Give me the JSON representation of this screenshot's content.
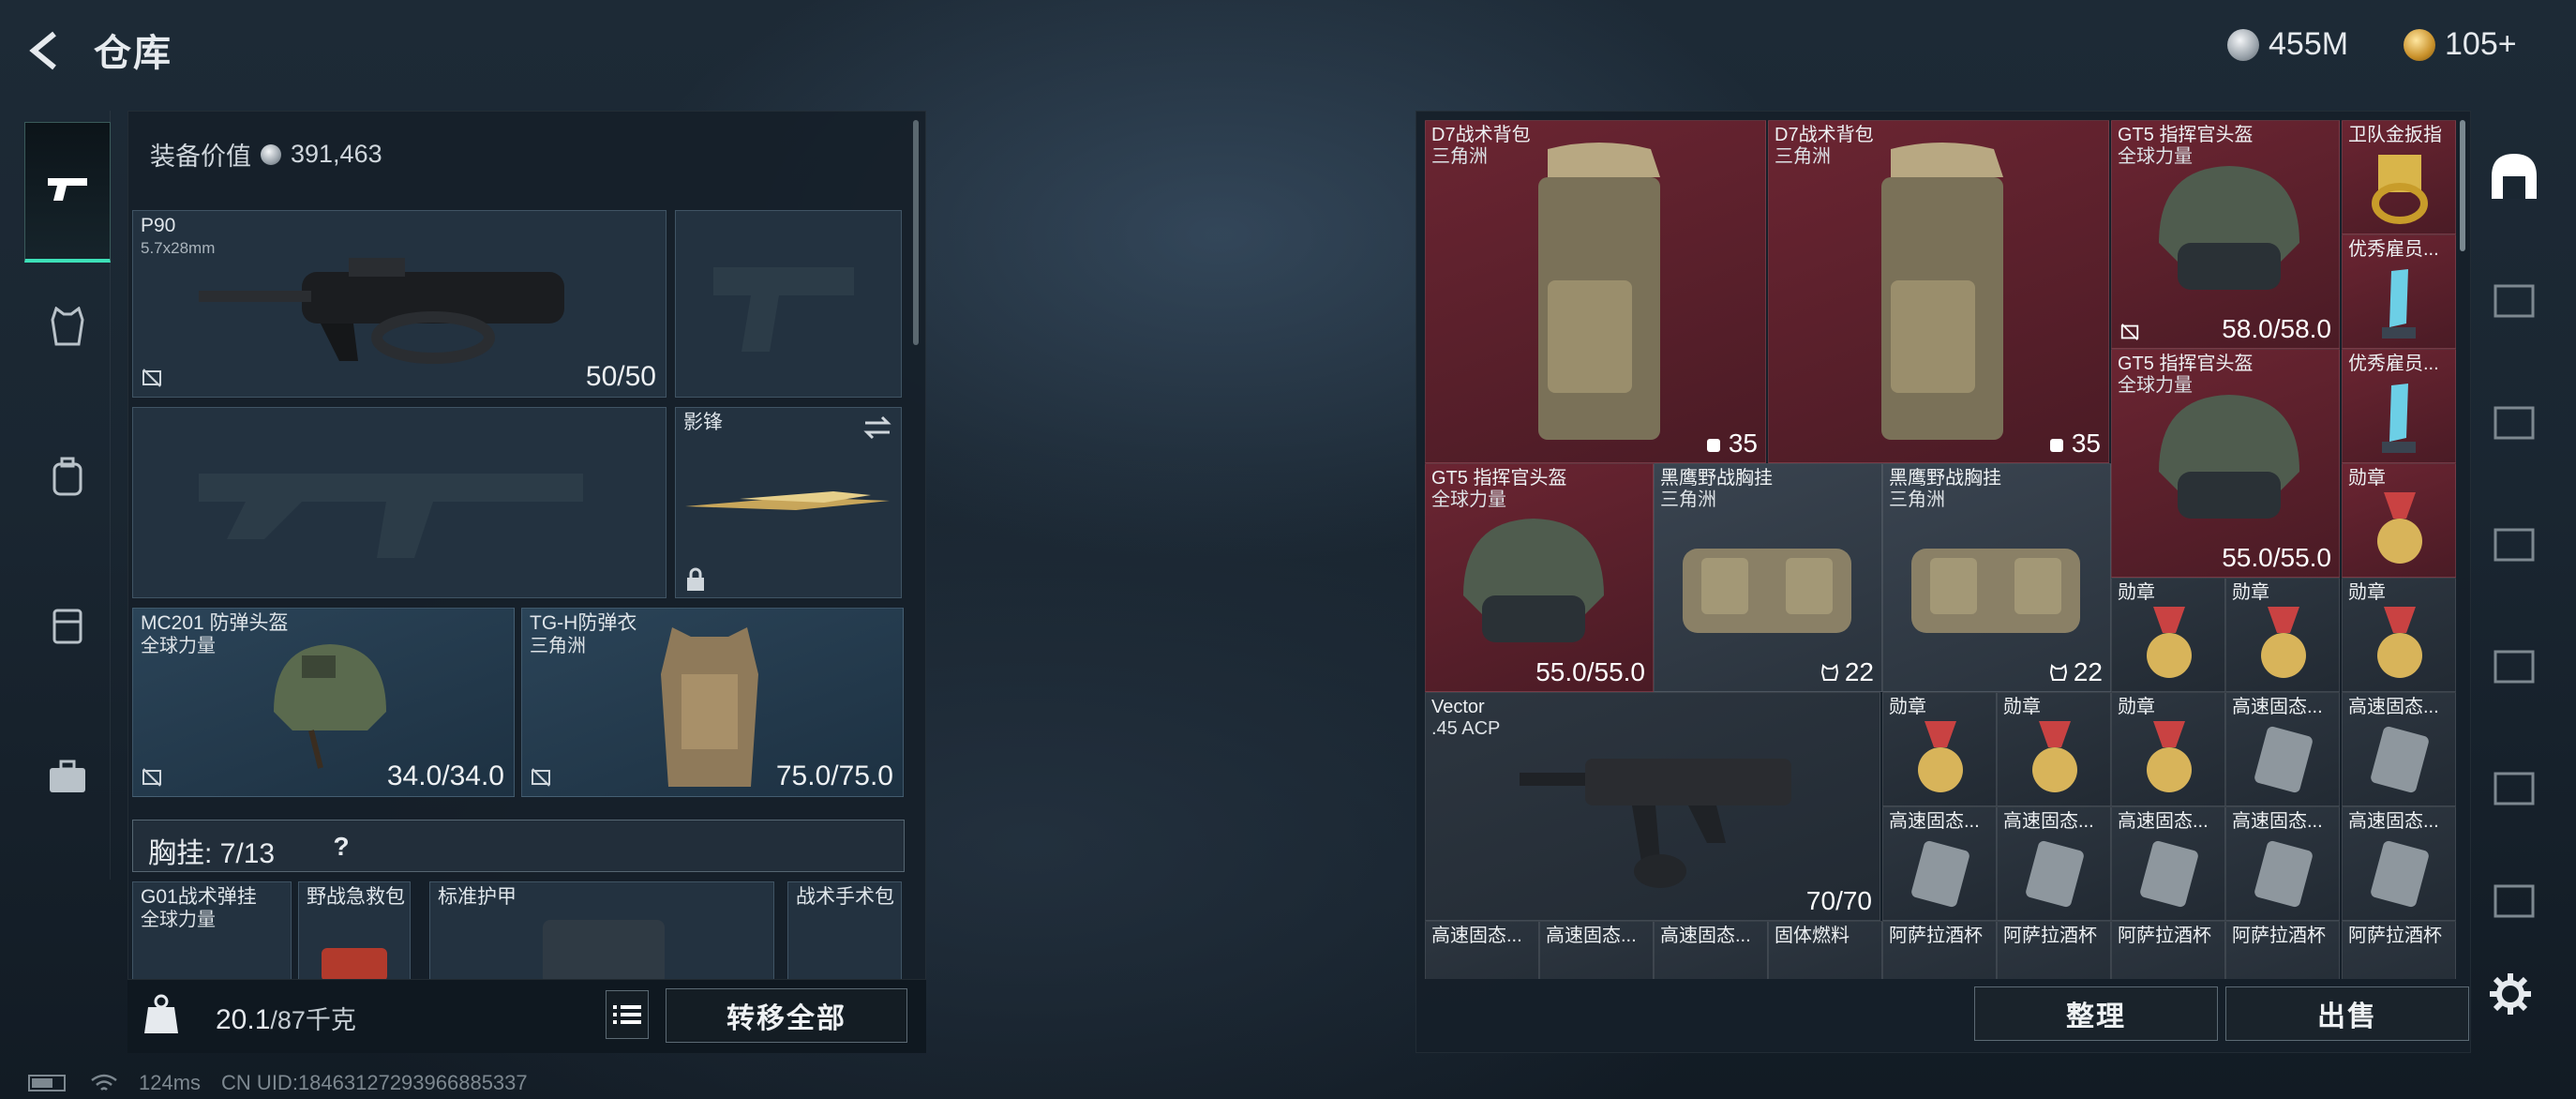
{
  "header": {
    "title": "仓库",
    "currency_silver": "455M",
    "currency_gold": "105+"
  },
  "rail_left": [
    "weapons",
    "armor",
    "backpack",
    "chest-rig",
    "case"
  ],
  "loadout": {
    "equip_value_label": "装备价值",
    "equip_value": "391,463",
    "primary": {
      "name": "P90",
      "ammo": "5.7x28mm",
      "durability": "50/50"
    },
    "melee": {
      "name": "影锋"
    },
    "helmet": {
      "name": "MC201 防弹头盔",
      "sub": "全球力量",
      "durability": "34.0/34.0"
    },
    "armor": {
      "name": "TG-H防弹衣",
      "sub": "三角洲",
      "durability": "75.0/75.0"
    },
    "chest_rig_label": "胸挂: 7/13",
    "chest_help": "?",
    "rig_items": [
      {
        "name": "G01战术弹挂",
        "sub": "全球力量"
      },
      {
        "name": "野战急救包"
      },
      {
        "name": "标准护甲"
      },
      {
        "name": "战术手术包"
      }
    ],
    "weight": "20.1",
    "weight_max": "/87千克",
    "transfer_all": "转移全部"
  },
  "stash": {
    "items": [
      {
        "name": "D7战术背包",
        "sub": "三角洲",
        "val": "35"
      },
      {
        "name": "D7战术背包",
        "sub": "三角洲",
        "val": "35"
      },
      {
        "name": "GT5 指挥官头盔",
        "sub": "全球力量",
        "val": "58.0/58.0"
      },
      {
        "name": "卫队金扳指"
      },
      {
        "name": "优秀雇员..."
      },
      {
        "name": "GT5 指挥官头盔",
        "sub": "全球力量",
        "val": "55.0/55.0"
      },
      {
        "name": "优秀雇员..."
      },
      {
        "name": "GT5 指挥官头盔",
        "sub": "全球力量",
        "val": "55.0/55.0"
      },
      {
        "name": "黑鹰野战胸挂",
        "sub": "三角洲",
        "val": "22"
      },
      {
        "name": "黑鹰野战胸挂",
        "sub": "三角洲",
        "val": "22"
      },
      {
        "name": "勋章"
      },
      {
        "name": "勋章"
      },
      {
        "name": "勋章"
      },
      {
        "name": "勋章"
      },
      {
        "name": "Vector",
        "sub": ".45 ACP",
        "val": "70/70"
      },
      {
        "name": "勋章"
      },
      {
        "name": "勋章"
      },
      {
        "name": "勋章"
      },
      {
        "name": "高速固态..."
      },
      {
        "name": "高速固态..."
      },
      {
        "name": "高速固态..."
      },
      {
        "name": "高速固态..."
      },
      {
        "name": "高速固态..."
      },
      {
        "name": "高速固态..."
      },
      {
        "name": "高速固态..."
      },
      {
        "name": "高速固态..."
      },
      {
        "name": "高速固态..."
      },
      {
        "name": "高速固态..."
      },
      {
        "name": "固体燃料"
      },
      {
        "name": "阿萨拉酒杯"
      },
      {
        "name": "阿萨拉酒杯"
      },
      {
        "name": "阿萨拉酒杯"
      },
      {
        "name": "阿萨拉酒杯"
      },
      {
        "name": "阿萨拉酒杯"
      }
    ],
    "sort_button": "整理",
    "sell_button": "出售"
  },
  "status": {
    "ping": "124ms",
    "uid": "CN UID:18463127293966885337"
  },
  "colors": {
    "accent": "#3de0b8",
    "rare_red": "#6b2532"
  }
}
